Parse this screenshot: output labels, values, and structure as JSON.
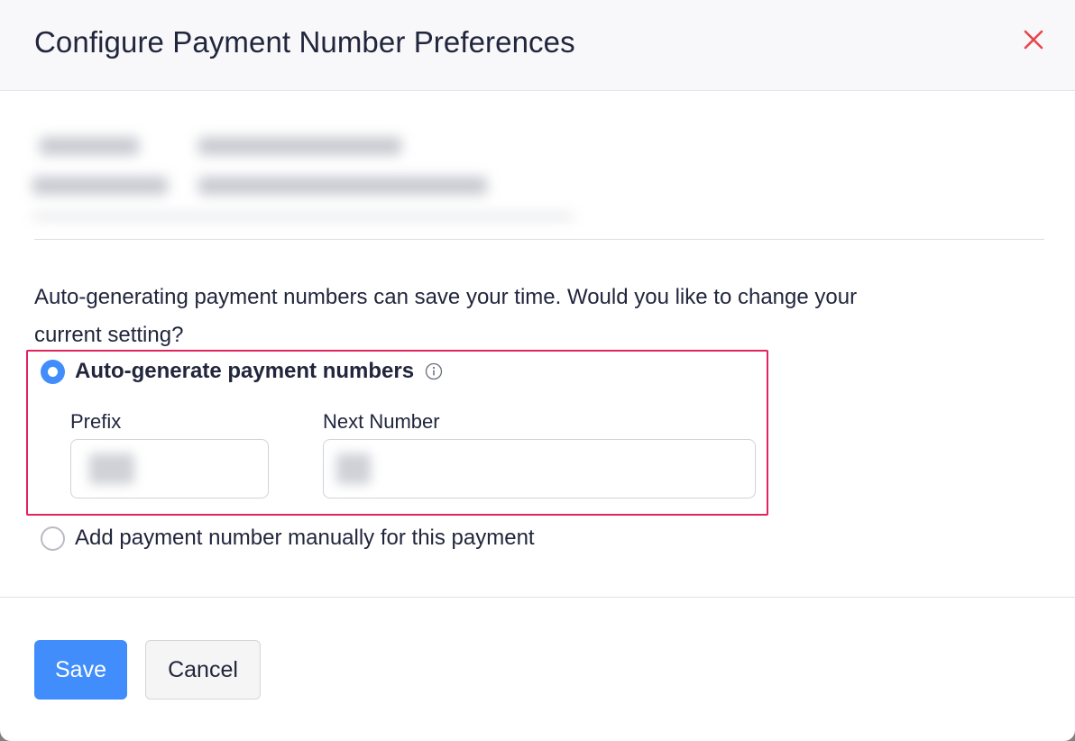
{
  "modal": {
    "title": "Configure Payment Number Preferences",
    "close_icon": "close-icon"
  },
  "question": "Auto-generating payment numbers can save your time. Would you like to change your current setting?",
  "options": {
    "auto": {
      "label": "Auto-generate payment numbers",
      "checked": true,
      "info_icon": "info-icon",
      "prefix_label": "Prefix",
      "next_number_label": "Next Number"
    },
    "manual": {
      "label": "Add payment number manually for this payment",
      "checked": false
    }
  },
  "footer": {
    "save_label": "Save",
    "cancel_label": "Cancel"
  },
  "colors": {
    "accent": "#408dfb",
    "highlight": "#e0245e",
    "close": "#e5484d"
  }
}
